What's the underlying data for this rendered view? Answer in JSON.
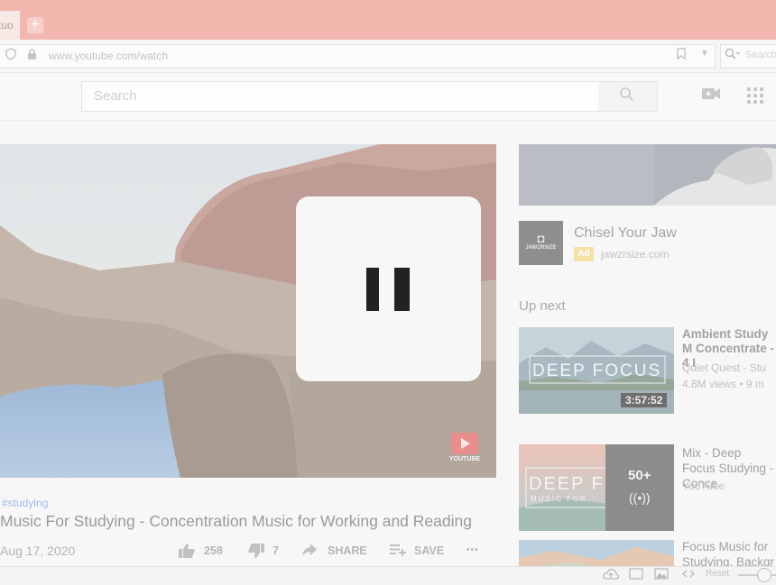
{
  "browser": {
    "tab_label": "tuo",
    "new_tab": "+",
    "url": "www.youtube.com/watch",
    "search_placeholder": "Search"
  },
  "youtube": {
    "search_placeholder": "Search",
    "video": {
      "hashtag": "#studying",
      "title": "Music For Studying - Concentration Music for Working and Reading",
      "date": "Aug 17, 2020",
      "likes": "258",
      "dislikes": "7",
      "share_label": "SHARE",
      "save_label": "SAVE",
      "more_label": "•••",
      "player_state": "paused",
      "watermark_text": "YOUTUBE"
    },
    "ad": {
      "logo_text": "JAWZRSIZE",
      "title": "Chisel Your Jaw",
      "badge": "Ad",
      "url": "jawzrsize.com"
    },
    "up_next_label": "Up next",
    "recommendations": [
      {
        "thumb_text": "DEEP FOCUS",
        "duration": "3:57:52",
        "title": "Ambient Study M Concentrate - 4 I",
        "channel": "Quiet Quest - Stu",
        "meta": "4.8M views • 9 m"
      },
      {
        "thumb_text": "DEEP F",
        "thumb_subtext": "MUSIC FOR",
        "count": "50+",
        "radio_icon": "((•))",
        "title": "Mix - Deep Focus Studying - Conce",
        "channel": "YouTube"
      },
      {
        "title": "Focus Music for Studying, Backgr"
      }
    ]
  },
  "statusbar": {
    "reset_label": "Reset"
  },
  "colors": {
    "tab_strip": "#f2b8b0",
    "ad_badge": "#f3e2a8",
    "hashtag": "#a9b6e8",
    "youtube_red": "#e98d8d"
  }
}
